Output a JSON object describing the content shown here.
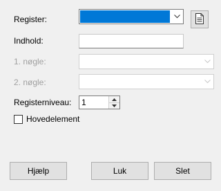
{
  "form": {
    "register_label": "Register:",
    "register_value": "",
    "content_label": "Indhold:",
    "content_value": "",
    "key1_label": "1. nøgle:",
    "key2_label": "2. nøgle:",
    "level_label": "Registerniveau:",
    "level_value": "1",
    "main_entry_label": "Hovedelement",
    "main_entry_checked": false
  },
  "icons": {
    "register_dropdown": "chevron-down-icon",
    "new_index": "document-icon",
    "spin_up": "arrow-up-icon",
    "spin_down": "arrow-down-icon"
  },
  "buttons": {
    "help": "Hjælp",
    "close": "Luk",
    "delete": "Slet"
  },
  "colors": {
    "selection": "#0078d7",
    "dialog_bg": "#f0f0f0",
    "button_bg": "#e1e1e1",
    "disabled_text": "#a0a0a0"
  }
}
